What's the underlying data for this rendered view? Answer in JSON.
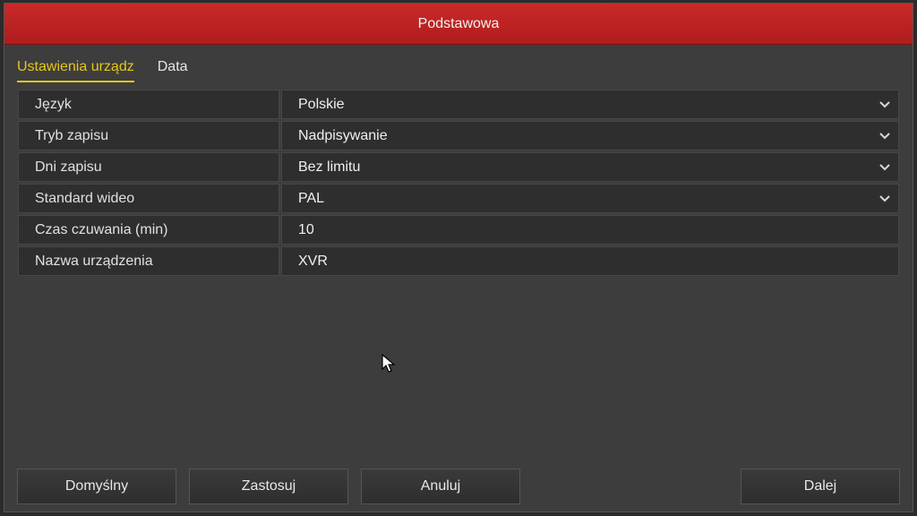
{
  "window": {
    "title": "Podstawowa"
  },
  "tabs": [
    {
      "label": "Ustawienia urządz",
      "active": true
    },
    {
      "label": "Data",
      "active": false
    }
  ],
  "settings": [
    {
      "label": "Język",
      "value": "Polskie",
      "dropdown": true
    },
    {
      "label": "Tryb zapisu",
      "value": "Nadpisywanie",
      "dropdown": true
    },
    {
      "label": "Dni zapisu",
      "value": "Bez limitu",
      "dropdown": true
    },
    {
      "label": "Standard wideo",
      "value": "PAL",
      "dropdown": true
    },
    {
      "label": "Czas czuwania (min)",
      "value": "10",
      "dropdown": false
    },
    {
      "label": "Nazwa urządzenia",
      "value": "XVR",
      "dropdown": false
    }
  ],
  "buttons": {
    "default_label": "Domyślny",
    "apply_label": "Zastosuj",
    "cancel_label": "Anuluj",
    "next_label": "Dalej"
  },
  "colors": {
    "titlebar": "#c92a2a",
    "active_tab": "#e6c619"
  },
  "icons": {
    "dropdown": "chevron-down-icon",
    "cursor": "mouse-pointer-icon"
  }
}
